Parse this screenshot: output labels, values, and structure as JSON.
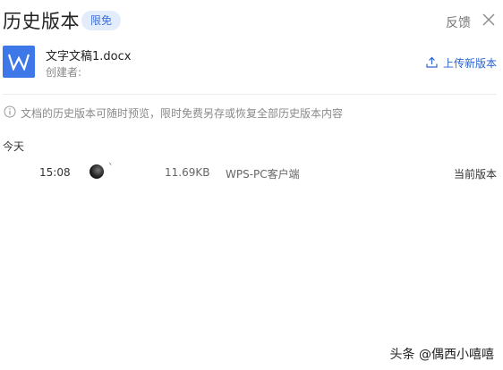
{
  "header": {
    "title": "历史版本",
    "badge": "限免",
    "feedback": "反馈"
  },
  "file": {
    "name": "文字文稿1.docx",
    "creator_label": "创建者:",
    "upload_label": "上传新版本"
  },
  "notice": "文档的历史版本可随时预览，限时免费另存或恢复全部历史版本内容",
  "versions": {
    "group_label": "今天",
    "items": [
      {
        "time": "15:08",
        "tick": "ˋ",
        "size": "11.69KB",
        "client": "WPS-PC客户端",
        "status": "当前版本"
      }
    ]
  },
  "watermark": "头条 @偶西小嘻嘻",
  "colors": {
    "accent": "#3e78e8",
    "badge_bg": "#e3ecfb",
    "link": "#2b63cf"
  }
}
